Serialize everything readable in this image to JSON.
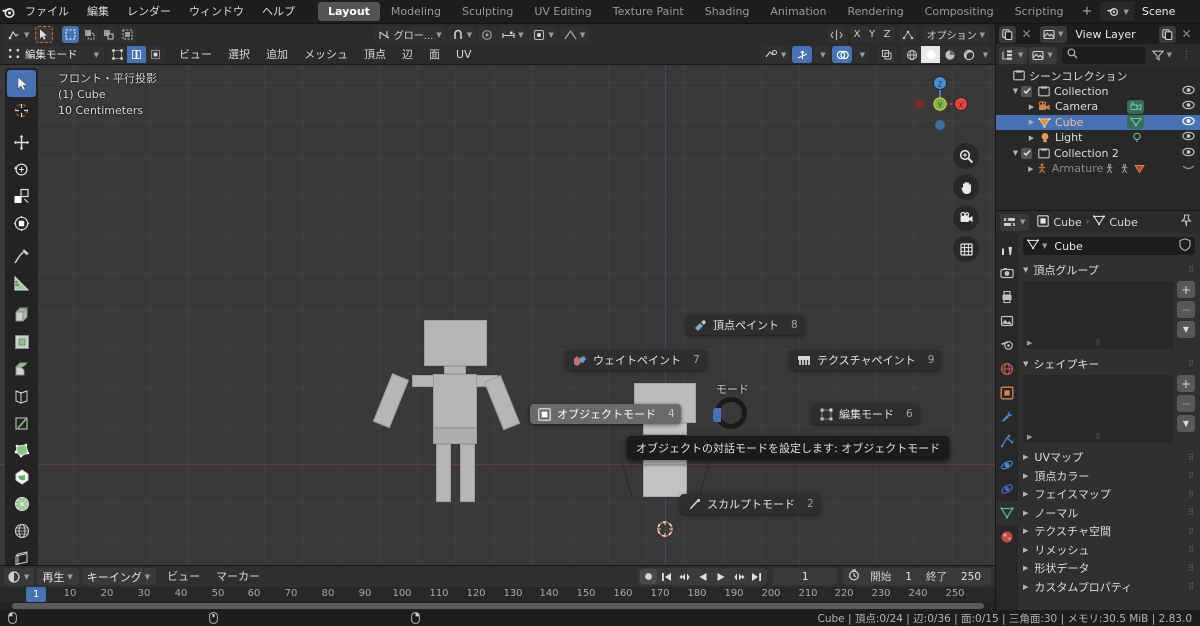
{
  "app": {
    "title": "Blender",
    "version": "2.83.0"
  },
  "topbar": {
    "logo_icon": "blender-logo-icon",
    "menus": [
      "ファイル",
      "編集",
      "レンダー",
      "ウィンドウ",
      "ヘルプ"
    ],
    "workspace_tabs": [
      {
        "label": "Layout",
        "active": true
      },
      {
        "label": "Modeling",
        "active": false
      },
      {
        "label": "Sculpting",
        "active": false
      },
      {
        "label": "UV Editing",
        "active": false
      },
      {
        "label": "Texture Paint",
        "active": false
      },
      {
        "label": "Shading",
        "active": false
      },
      {
        "label": "Animation",
        "active": false
      },
      {
        "label": "Rendering",
        "active": false
      },
      {
        "label": "Compositing",
        "active": false
      },
      {
        "label": "Scripting",
        "active": false
      }
    ],
    "add_workspace": "+",
    "scene_name": "Scene",
    "view_layer_name": "View Layer",
    "scene_icon": "scene-icon",
    "viewlayer_icon": "view-layer-icon",
    "new_scene_icon": "new-scene-icon",
    "delete_scene_icon": "delete-scene-icon"
  },
  "viewport_header": {
    "editor_type_icon": "editor-type-icon",
    "cursor_tool_icon": "select-box-tool-icon",
    "select_modes": [
      "select-set-icon",
      "select-extend-icon",
      "select-subtract-icon",
      "select-invert-icon"
    ],
    "transform_orientation": "グロー...",
    "snap_icon": "magnet-icon",
    "proportional_icon": "proportional-edit-icon",
    "proportional_falloff_icon": "falloff-curve-icon",
    "mirror_x_icon": "mirror-icon",
    "options_label": "オプション",
    "axis_buttons": [
      "X",
      "Y",
      "Z"
    ],
    "mesh_symmetry_icon": "mesh-symmetry-icon",
    "topology_mirror_icon": "topology-mirror-icon"
  },
  "viewport_header2": {
    "mode_label": "編集モード",
    "mode_icon": "edit-mode-icon",
    "select_mode_vertex": "vertex-select-icon",
    "select_mode_edge": "edge-select-icon",
    "select_mode_face": "face-select-icon",
    "menus": [
      "ビュー",
      "選択",
      "追加",
      "メッシュ",
      "頂点",
      "辺",
      "面",
      "UV"
    ],
    "visibility_icon": "show-overlays-icon",
    "gizmo_icon": "gizmo-icon",
    "overlays_icon": "overlays-icon",
    "xray_icon": "toggle-xray-icon",
    "shading_modes": [
      "wireframe-shading-icon",
      "solid-shading-icon",
      "material-preview-icon",
      "rendered-shading-icon"
    ]
  },
  "viewport": {
    "overlay_text": [
      "フロント・平行投影",
      "(1) Cube",
      "10 Centimeters"
    ],
    "nav_buttons": [
      "zoom-icon",
      "hand-move-icon",
      "camera-view-icon",
      "orthographic-toggle-icon"
    ],
    "gizmo_axes": [
      "X",
      "Y",
      "Z"
    ],
    "cursor_icon": "3d-cursor-icon"
  },
  "left_toolbar": {
    "tools": [
      {
        "name": "tweak-tool",
        "icon": "cursor-arrow-icon",
        "active": true
      },
      {
        "name": "cursor-tool",
        "icon": "3d-cursor-tool-icon",
        "active": false
      },
      {
        "name": "move-tool",
        "icon": "move-arrows-icon",
        "active": false
      },
      {
        "name": "rotate-tool",
        "icon": "rotate-icon",
        "active": false
      },
      {
        "name": "scale-tool",
        "icon": "scale-icon",
        "active": false
      },
      {
        "name": "transform-tool",
        "icon": "transform-icon",
        "active": false
      },
      {
        "name": "annotate-tool",
        "icon": "annotate-pencil-icon",
        "active": false
      },
      {
        "name": "measure-tool",
        "icon": "measure-ruler-icon",
        "active": false
      },
      {
        "name": "extrude-region-tool",
        "icon": "extrude-region-icon",
        "active": false
      },
      {
        "name": "inset-faces-tool",
        "icon": "inset-faces-icon",
        "active": false
      },
      {
        "name": "bevel-tool",
        "icon": "bevel-icon",
        "active": false
      },
      {
        "name": "loop-cut-tool",
        "icon": "loop-cut-icon",
        "active": false
      },
      {
        "name": "knife-tool",
        "icon": "knife-icon",
        "active": false
      },
      {
        "name": "poly-build-tool",
        "icon": "poly-build-icon",
        "active": false
      },
      {
        "name": "spin-tool",
        "icon": "spin-icon",
        "active": false
      },
      {
        "name": "smooth-tool",
        "icon": "smooth-vertex-icon",
        "active": false
      },
      {
        "name": "shrink-fatten-tool",
        "icon": "shrink-fatten-icon",
        "active": false
      },
      {
        "name": "shear-tool",
        "icon": "shear-icon",
        "active": false
      }
    ]
  },
  "pie_menu": {
    "center_label": "モード",
    "items": [
      {
        "label": "頂点ペイント",
        "number": "8",
        "icon": "vertex-paint-icon",
        "highlighted": false,
        "pos": "top"
      },
      {
        "label": "ウェイトペイント",
        "number": "7",
        "icon": "weight-paint-icon",
        "highlighted": false,
        "pos": "topleft"
      },
      {
        "label": "テクスチャペイント",
        "number": "9",
        "icon": "texture-paint-icon",
        "highlighted": false,
        "pos": "topright"
      },
      {
        "label": "オブジェクトモード",
        "number": "4",
        "icon": "object-mode-icon",
        "highlighted": true,
        "pos": "left"
      },
      {
        "label": "編集モード",
        "number": "6",
        "icon": "edit-mode-icon",
        "highlighted": false,
        "pos": "right"
      },
      {
        "label": "スカルプトモード",
        "number": "2",
        "icon": "sculpt-mode-icon",
        "highlighted": false,
        "pos": "bottom"
      }
    ],
    "tooltip": "オブジェクトの対話モードを設定します: オブジェクトモード"
  },
  "timeline": {
    "editor_icon": "timeline-editor-icon",
    "menus": [
      "再生",
      "キーイング",
      "ビュー",
      "マーカー"
    ],
    "playback_buttons": [
      "record-icon",
      "jump-to-start-icon",
      "previous-keyframe-icon",
      "play-reverse-icon",
      "play-icon",
      "next-keyframe-icon",
      "jump-to-end-icon"
    ],
    "current_frame": "1",
    "clock_icon": "auto-key-icon",
    "start_label": "開始",
    "start_value": "1",
    "end_label": "終了",
    "end_value": "250",
    "ticks": [
      "10",
      "20",
      "30",
      "40",
      "50",
      "60",
      "70",
      "80",
      "90",
      "100",
      "110",
      "120",
      "130",
      "140",
      "150",
      "160",
      "170",
      "180",
      "190",
      "200",
      "210",
      "220",
      "230",
      "240",
      "250"
    ],
    "playhead_label": "1"
  },
  "outliner": {
    "editor_icon": "outliner-editor-icon",
    "display_mode_icon": "display-mode-icon",
    "filter_icon": "filter-icon",
    "search_icon": "search-icon",
    "search_placeholder": "",
    "new_collection_icon": "new-collection-icon",
    "rows": [
      {
        "label": "シーンコレクション",
        "indent": 0,
        "icon": "scene-collection-icon",
        "disclosure": "",
        "checkbox": false,
        "eye": false,
        "selected": false
      },
      {
        "label": "Collection",
        "indent": 1,
        "icon": "collection-icon",
        "disclosure": "▼",
        "checkbox": true,
        "eye": true,
        "selected": false
      },
      {
        "label": "Camera",
        "indent": 2,
        "icon": "camera-icon",
        "disclosure": "▶",
        "checkbox": false,
        "eye": true,
        "selected": false,
        "data_icon": "camera-data-icon"
      },
      {
        "label": "Cube",
        "indent": 2,
        "icon": "mesh-data-icon",
        "disclosure": "▶",
        "checkbox": false,
        "eye": true,
        "selected": true,
        "data_icon": "mesh-obj-data-icon"
      },
      {
        "label": "Light",
        "indent": 2,
        "icon": "light-icon",
        "disclosure": "▶",
        "checkbox": false,
        "eye": true,
        "selected": false,
        "data_icon": "light-data-icon"
      },
      {
        "label": "Collection 2",
        "indent": 1,
        "icon": "collection-icon",
        "disclosure": "▼",
        "checkbox": true,
        "eye": true,
        "selected": false
      },
      {
        "label": "Armature",
        "indent": 2,
        "icon": "armature-icon",
        "disclosure": "▶",
        "checkbox": false,
        "eye": false,
        "selected": false,
        "dimmed": true
      }
    ]
  },
  "properties": {
    "editor_icon": "properties-editor-icon",
    "breadcrumb": [
      {
        "label": "Cube",
        "icon": "object-icon"
      },
      {
        "label": "Cube",
        "icon": "mesh-data-icon"
      }
    ],
    "pin_icon": "pin-icon",
    "tabs": [
      {
        "name": "tool-tab",
        "icon": "tool-icon",
        "active": false
      },
      {
        "name": "render-tab",
        "icon": "render-camera-icon",
        "active": false
      },
      {
        "name": "output-tab",
        "icon": "printer-icon",
        "active": false
      },
      {
        "name": "view-layer-tab",
        "icon": "images-icon",
        "active": false
      },
      {
        "name": "scene-tab",
        "icon": "scene-props-icon",
        "active": false
      },
      {
        "name": "world-tab",
        "icon": "world-globe-icon",
        "active": false
      },
      {
        "name": "object-tab",
        "icon": "object-square-icon",
        "active": false
      },
      {
        "name": "modifier-tab",
        "icon": "wrench-icon",
        "active": false
      },
      {
        "name": "particles-tab",
        "icon": "particles-icon",
        "active": false
      },
      {
        "name": "physics-tab",
        "icon": "physics-orbit-icon",
        "active": false
      },
      {
        "name": "constraints-tab",
        "icon": "constraint-icon",
        "active": false
      },
      {
        "name": "data-tab",
        "icon": "mesh-data-triangle-icon",
        "active": true
      },
      {
        "name": "material-tab",
        "icon": "material-sphere-icon",
        "active": false
      }
    ],
    "name_field": {
      "value": "Cube",
      "icon": "mesh-data-icon",
      "shield_icon": "fake-user-shield-icon"
    },
    "panels": [
      {
        "label": "頂点グループ",
        "expanded": true,
        "type": "list"
      },
      {
        "label": "シェイプキー",
        "expanded": true,
        "type": "list"
      }
    ],
    "collapsed_panels": [
      "UVマップ",
      "頂点カラー",
      "フェイスマップ",
      "ノーマル",
      "テクスチャ空間",
      "リメッシュ",
      "形状データ",
      "カスタムプロパティ"
    ],
    "list_add_icon": "+",
    "list_remove_icon": "−",
    "list_menu_icon": "chevron-down-icon"
  },
  "statusbar": {
    "mouse_hints": [
      "left-mouse-icon",
      "middle-mouse-icon",
      "right-mouse-icon"
    ],
    "info": "Cube | 頂点:0/24 | 辺:0/36 | 面:0/15 | 三角面:30 | メモリ:30.5 MiB | 2.83.0"
  },
  "colors": {
    "accent": "#4772b3",
    "viewport_bg": "#393939",
    "panel_bg": "#303030",
    "header_bg": "#2b2b2b",
    "dark_bg": "#1d1d1d",
    "axis_x": "#6a3b40",
    "axis_z": "#3a4f66",
    "object_gray": "#b6b6b6"
  }
}
